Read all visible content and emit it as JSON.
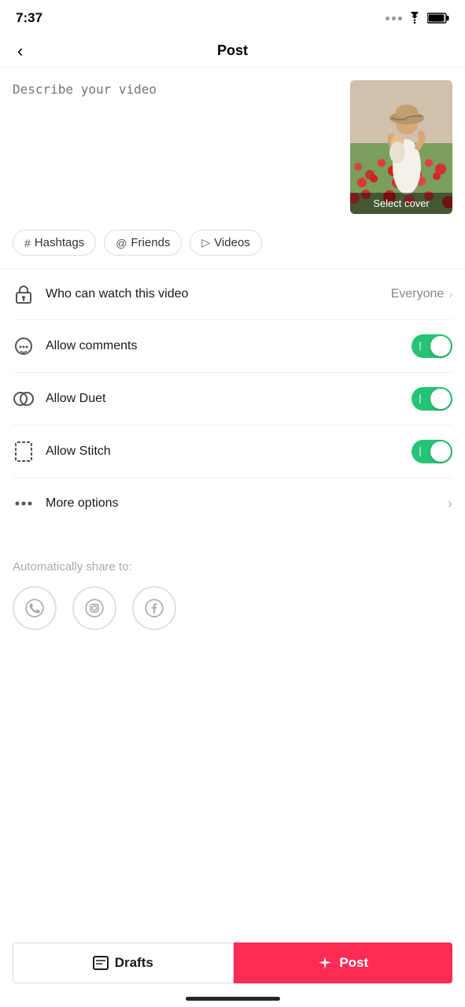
{
  "statusBar": {
    "time": "7:37"
  },
  "header": {
    "title": "Post",
    "backLabel": "‹"
  },
  "videoSection": {
    "descriptionPlaceholder": "Describe your video",
    "selectCoverLabel": "Select cover"
  },
  "tagPills": [
    {
      "icon": "#",
      "label": "Hashtags"
    },
    {
      "icon": "@",
      "label": "Friends"
    },
    {
      "icon": "▷",
      "label": "Videos"
    }
  ],
  "settings": {
    "watchVisibility": {
      "label": "Who can watch this video",
      "value": "Everyone"
    },
    "allowComments": {
      "label": "Allow comments",
      "enabled": true
    },
    "allowDuet": {
      "label": "Allow Duet",
      "enabled": true
    },
    "allowStitch": {
      "label": "Allow Stitch",
      "enabled": true
    },
    "moreOptions": {
      "label": "More options"
    }
  },
  "shareSection": {
    "label": "Automatically share to:"
  },
  "bottomBar": {
    "draftsLabel": "Drafts",
    "postLabel": "Post"
  }
}
